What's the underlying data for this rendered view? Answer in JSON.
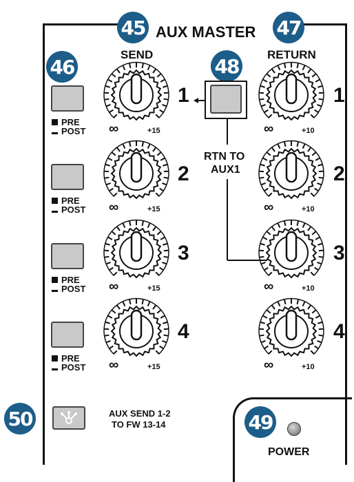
{
  "header": {
    "title": "AUX MASTER",
    "send_label": "SEND",
    "return_label": "RETURN"
  },
  "callouts": {
    "c45": "45",
    "c46": "46",
    "c47": "47",
    "c48": "48",
    "c49": "49",
    "c50": "50"
  },
  "send_channels": [
    {
      "number": "1",
      "pre": "PRE",
      "post": "POST",
      "min": "∞",
      "max": "+15"
    },
    {
      "number": "2",
      "pre": "PRE",
      "post": "POST",
      "min": "∞",
      "max": "+15"
    },
    {
      "number": "3",
      "pre": "PRE",
      "post": "POST",
      "min": "∞",
      "max": "+15"
    },
    {
      "number": "4",
      "pre": "PRE",
      "post": "POST",
      "min": "∞",
      "max": "+15"
    }
  ],
  "return_channels": [
    {
      "number": "1",
      "min": "∞",
      "max": "+10"
    },
    {
      "number": "2",
      "min": "∞",
      "max": "+10"
    },
    {
      "number": "3",
      "min": "∞",
      "max": "+10"
    },
    {
      "number": "4",
      "min": "∞",
      "max": "+10"
    }
  ],
  "rtn_to_aux": {
    "line1": "RTN TO",
    "line2": "AUX1"
  },
  "fw_send": {
    "line1": "AUX SEND 1-2",
    "line2": "TO FW 13-14",
    "icon": "firewire-icon"
  },
  "power": {
    "label": "POWER"
  },
  "colors": {
    "badge": "#1c5d89",
    "button": "#c9c9c9",
    "led": "#9a9a9a"
  }
}
